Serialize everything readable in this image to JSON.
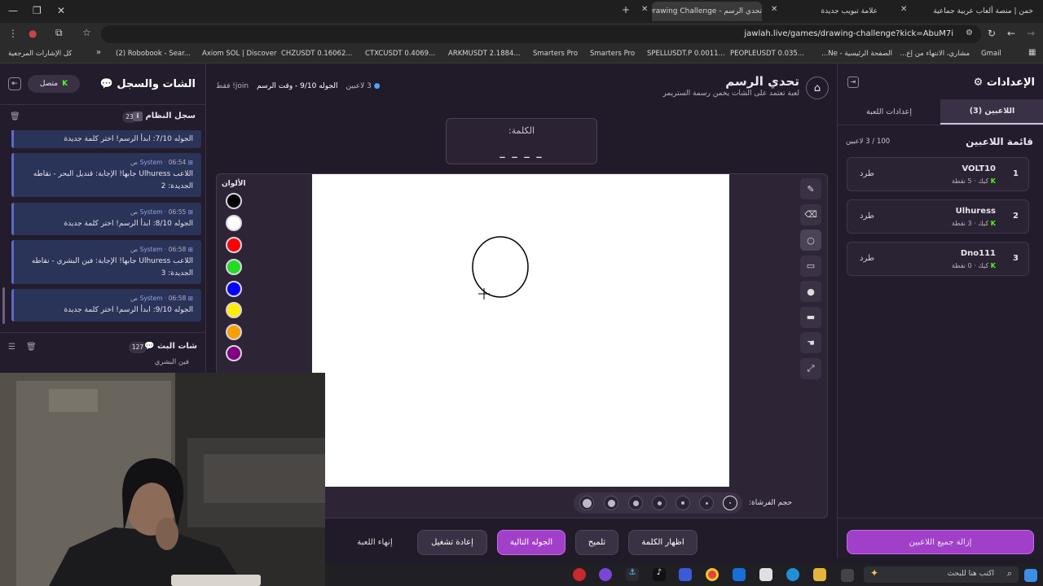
{
  "browser": {
    "tabs": [
      {
        "title": "خمن | منصة ألعاب عربية جماعية"
      },
      {
        "title": "علامة تبويب جديدة"
      },
      {
        "title": "تحدي الرسم - Drawing Challenge"
      }
    ],
    "url": "jawlah.live/games/drawing-challenge?kick=AbuM7i",
    "bookmarks": [
      "Gmail",
      "مشاري، الانتهاء من إع...",
      "الصفحة الرئيسية - Ne...",
      "PEOPLEUSDT 0.035...",
      "SPELLUSDT.P 0.0011...",
      "Smarters Pro",
      "Smarters Pro",
      "ARKMUSDT 2.1884...",
      "CTXCUSDT 0.4069...",
      "CHZUSDT 0.16062...",
      "Axiom SOL | Discover",
      "(2) Robobook - Sear...",
      "كل الإشارات المرجعية"
    ]
  },
  "chat": {
    "title": "الشات والسجل",
    "status": "متصل",
    "log_title": "سجل النظام",
    "log_count": "23",
    "messages": [
      {
        "sender": "",
        "time": "",
        "text": "الجوله 7/10: ابدأ الرسم! اختر كلمة جديدة"
      },
      {
        "sender": "System",
        "time": "06:54 ص",
        "text": "اللاعب Ulhuress جابها! الإجابة: قنديل البحر - نقاطه الجديدة: 2"
      },
      {
        "sender": "System",
        "time": "06:55 ص",
        "text": "الجوله 8/10: ابدأ الرسم! اختر كلمة جديدة"
      },
      {
        "sender": "System",
        "time": "06:58 ص",
        "text": "اللاعب Ulhuress جابها! الإجابة: فين البشري - نقاطه الجديدة: 3"
      },
      {
        "sender": "System",
        "time": "06:58 ص",
        "text": "الجوله 9/10: ابدأ الرسم! اختر كلمة جديدة"
      }
    ],
    "stream_title": "شات البث",
    "stream_count": "127",
    "stream_preview": "فين البشري"
  },
  "game": {
    "title": "تحدي الرسم",
    "subtitle": "لعبة تعتمد على الشات يخمن رسمة الستريمر",
    "players_count": "3 لاعبين",
    "round_info": "الجوله 9/10 - وقت الرسم",
    "join_hint": "join! فقط",
    "word_label": "الكلمة:",
    "word_mask": "_ _ _ _",
    "colors_label": "الألوان",
    "colors": [
      "#000000",
      "#ffffff",
      "#ff0000",
      "#22dd22",
      "#0000ff",
      "#ffee00",
      "#f5a000",
      "#800080"
    ],
    "tools": [
      "pen-icon",
      "eraser-icon",
      "circle-icon",
      "rectangle-icon",
      "filled-circle-icon",
      "filled-rect-icon",
      "fill-bucket-icon",
      "line-icon"
    ],
    "brush_label": "حجم الفرشاة:",
    "buttons": {
      "show_word": "اظهار الكلمة",
      "hint": "تلميح",
      "next_round": "الجوله التالية",
      "restart": "إعادة تشغيل",
      "end_game": "إنهاء اللعبة"
    }
  },
  "settings": {
    "title": "الإعدادات",
    "tab_players": "اللاعبين (3)",
    "tab_game": "إعدادات اللعبة",
    "list_title": "قائمة اللاعبين",
    "capacity": "100 / 3 لاعبين",
    "kick_label": "طرد",
    "players": [
      {
        "rank": "1",
        "name": "VOLT10",
        "platform": "كيك",
        "points": "5 نقطة"
      },
      {
        "rank": "2",
        "name": "Ulhuress",
        "platform": "كيك",
        "points": "3 نقطة"
      },
      {
        "rank": "3",
        "name": "Dno111",
        "platform": "كيك",
        "points": "0 نقطة"
      }
    ],
    "remove_all": "إزالة جميع اللاعبين"
  },
  "taskbar": {
    "search_placeholder": "اكتب هنا للبحث"
  }
}
